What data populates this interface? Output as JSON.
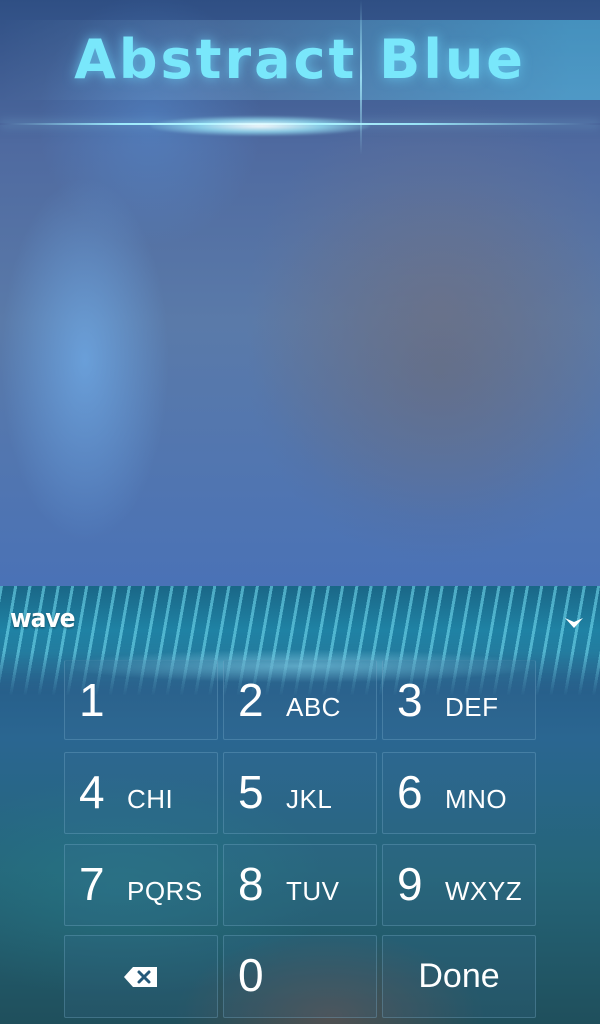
{
  "wallpaper": {
    "title": "Abstract Blue",
    "title_color": "#79e7fb"
  },
  "keyboard": {
    "logo": "wave",
    "collapse_icon": "chevron-down-icon",
    "keys": [
      {
        "digit": "1",
        "letters": ""
      },
      {
        "digit": "2",
        "letters": "ABC"
      },
      {
        "digit": "3",
        "letters": "DEF"
      },
      {
        "digit": "4",
        "letters": "CHI"
      },
      {
        "digit": "5",
        "letters": "JKL"
      },
      {
        "digit": "6",
        "letters": "MNO"
      },
      {
        "digit": "7",
        "letters": "PQRS"
      },
      {
        "digit": "8",
        "letters": "TUV"
      },
      {
        "digit": "9",
        "letters": "WXYZ"
      }
    ],
    "backspace_icon": "backspace-icon",
    "zero": "0",
    "done_label": "Done",
    "accent_color": "#2a6691"
  }
}
